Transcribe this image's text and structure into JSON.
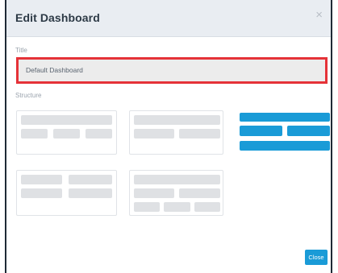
{
  "dialog": {
    "title": "Edit Dashboard",
    "close_glyph": "×"
  },
  "form": {
    "title_label": "Title",
    "title_value": "Default Dashboard",
    "structure_label": "Structure"
  },
  "structure_options": [
    {
      "name": "layout-1-3",
      "selected": false
    },
    {
      "name": "layout-2-2",
      "selected": false
    },
    {
      "name": "layout-1-2-1",
      "selected": true
    },
    {
      "name": "layout-2-2-b",
      "selected": false
    },
    {
      "name": "layout-1-2-3",
      "selected": false
    }
  ],
  "footer": {
    "close_label": "Close"
  },
  "colors": {
    "accent": "#1a9bd7",
    "highlight_border": "#e53238",
    "placeholder_bar": "#dfe1e4"
  }
}
